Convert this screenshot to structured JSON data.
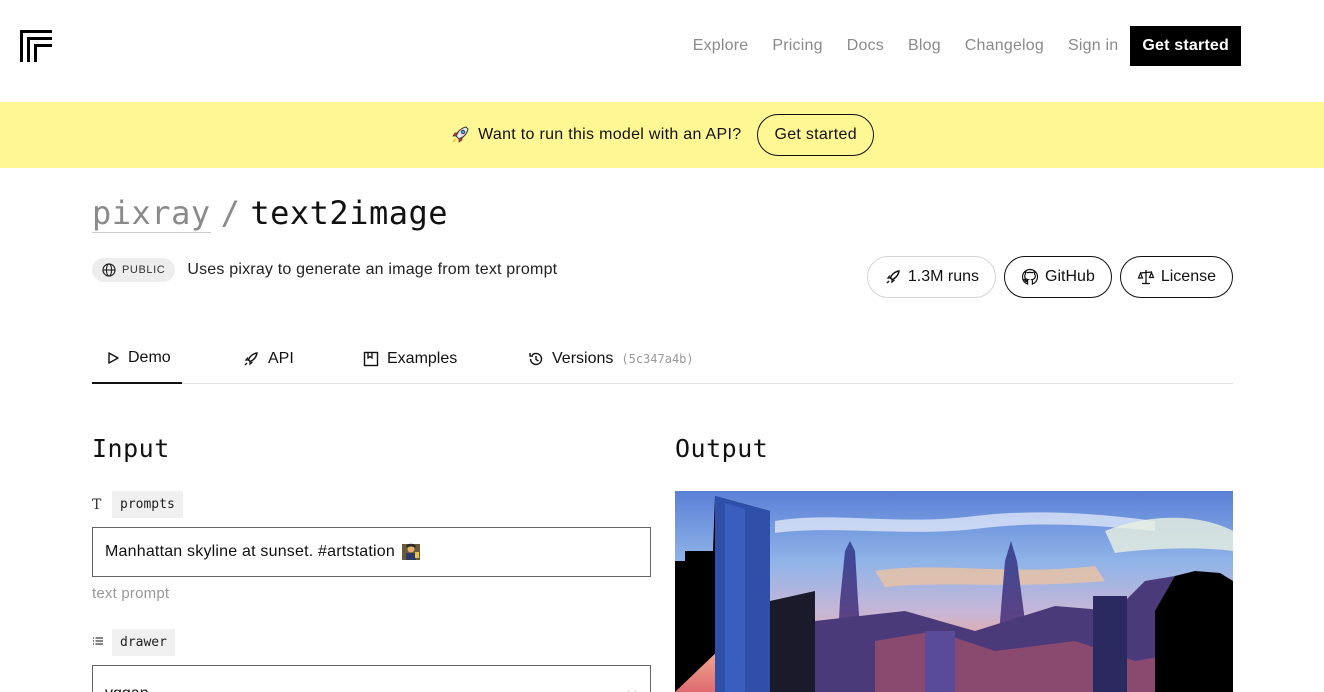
{
  "nav": {
    "links": [
      "Explore",
      "Pricing",
      "Docs",
      "Blog",
      "Changelog",
      "Sign in"
    ],
    "cta": "Get started"
  },
  "banner": {
    "message": "Want to run this model with an API?",
    "button": "Get started",
    "background": "#fff694"
  },
  "model": {
    "owner": "pixray",
    "separator": "/",
    "name": "text2image",
    "visibility": "PUBLIC",
    "description": "Uses pixray to generate an image from text prompt"
  },
  "actions": {
    "runs": "1.3M runs",
    "github": "GitHub",
    "license": "License"
  },
  "tabs": {
    "demo": "Demo",
    "api": "API",
    "examples": "Examples",
    "versions": "Versions",
    "version_hash": "(5c347a4b)"
  },
  "input": {
    "heading": "Input",
    "prompts_label": "prompts",
    "prompts_value": "Manhattan skyline at sunset. #artstation",
    "prompts_hint": "text prompt",
    "drawer_label": "drawer",
    "drawer_value": "vqgan"
  },
  "output": {
    "heading": "Output"
  },
  "icons": [
    "logo-icon",
    "rocket-icon",
    "globe-icon",
    "github-icon",
    "scale-icon",
    "play-icon",
    "book-icon",
    "history-icon",
    "text-icon",
    "list-icon",
    "chevron-down-icon",
    "artist-emoji-icon"
  ]
}
